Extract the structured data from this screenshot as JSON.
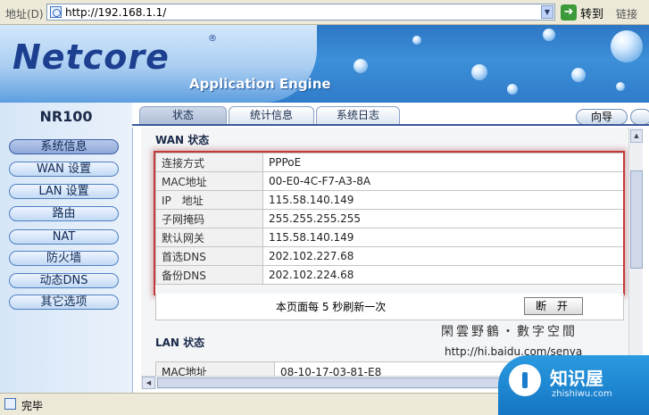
{
  "browser": {
    "address_label": "地址(D)",
    "url": "http://192.168.1.1/",
    "go_label": "转到",
    "links_label": "链接",
    "status_text": "完毕"
  },
  "banner": {
    "logo_text": "Netcore",
    "tagline": "Application Engine"
  },
  "sidebar": {
    "model": "NR100",
    "items": [
      {
        "label": "系统信息",
        "active": true
      },
      {
        "label": "WAN 设置"
      },
      {
        "label": "LAN 设置"
      },
      {
        "label": "路由"
      },
      {
        "label": "NAT"
      },
      {
        "label": "防火墙"
      },
      {
        "label": "动态DNS"
      },
      {
        "label": "其它选项"
      }
    ]
  },
  "tabs": [
    {
      "label": "状态",
      "active": true
    },
    {
      "label": "统计信息"
    },
    {
      "label": "系统日志"
    }
  ],
  "guide_label": "向导",
  "wan": {
    "title": "WAN 状态",
    "rows": [
      {
        "key": "连接方式",
        "value": "PPPoE"
      },
      {
        "key": "MAC地址",
        "value": "00-E0-4C-F7-A3-8A"
      },
      {
        "key": "IP　地址",
        "value": "115.58.140.149"
      },
      {
        "key": "子网掩码",
        "value": "255.255.255.255"
      },
      {
        "key": "默认网关",
        "value": "115.58.140.149"
      },
      {
        "key": "首选DNS",
        "value": "202.102.227.68"
      },
      {
        "key": "备份DNS",
        "value": "202.102.224.68"
      }
    ],
    "refresh_text": "本页面每  5 秒刷新一次",
    "disconnect_label": "断 开"
  },
  "watermark": {
    "line1": "閑雲野鶴・數字空間",
    "line2": "http://hi.baidu.com/senya"
  },
  "lan": {
    "title": "LAN 状态",
    "rows": [
      {
        "key": "MAC地址",
        "value": "08-10-17-03-81-E8"
      }
    ]
  },
  "corner_badge": {
    "title": "知识屋",
    "subtitle": "zhishiwu.com"
  },
  "colors": {
    "banner_blue": "#2d77c4",
    "highlight_red": "#c23a3a",
    "badge_blue": "#1476c4"
  }
}
